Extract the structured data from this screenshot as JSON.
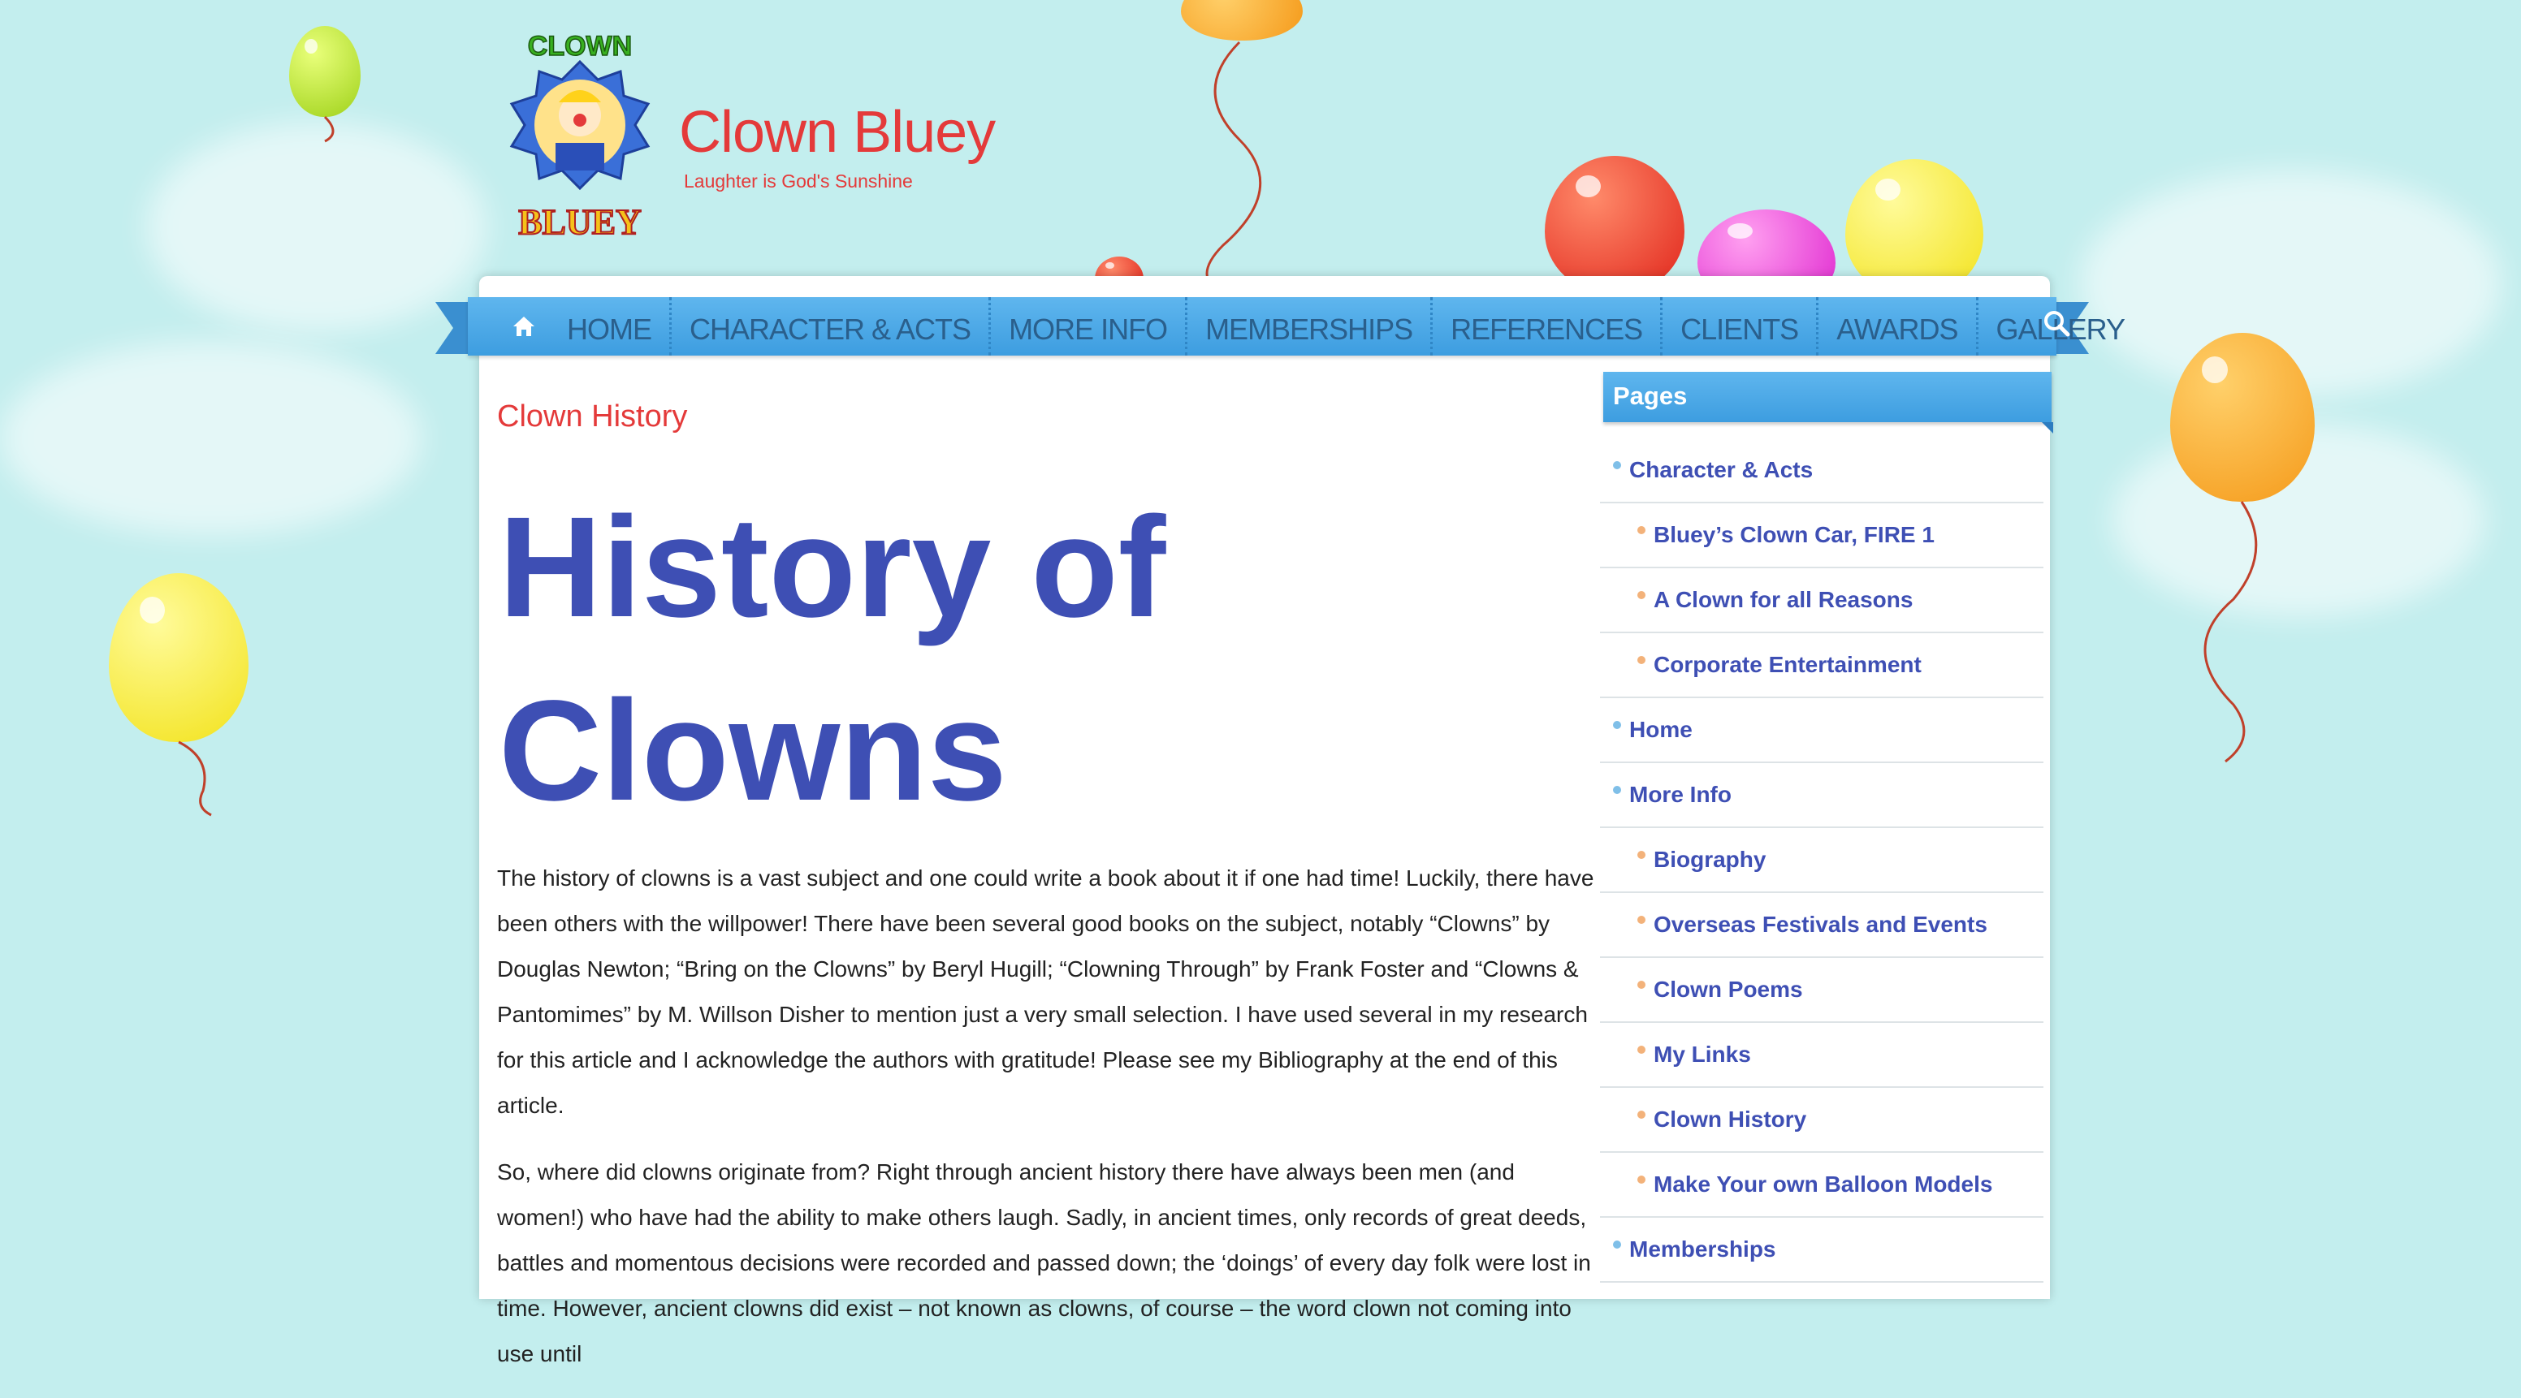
{
  "site": {
    "title": "Clown Bluey",
    "tagline": "Laughter is God's Sunshine",
    "logo_text_top": "CLOWN",
    "logo_text_bottom": "BLUEY"
  },
  "nav": {
    "items": [
      "HOME",
      "CHARACTER & ACTS",
      "MORE INFO",
      "MEMBERSHIPS",
      "REFERENCES",
      "CLIENTS",
      "AWARDS",
      "GALLERY"
    ],
    "home_icon": "home-icon",
    "search_icon": "search-icon"
  },
  "main": {
    "page_title": "Clown History",
    "headline_line1": "History of",
    "headline_line2": "Clowns",
    "paragraphs": [
      "The history of clowns is a vast subject and one could write a book about it if one had time! Luckily, there have been others with the willpower! There have been several good books on the subject, notably “Clowns” by Douglas Newton; “Bring on the Clowns” by Beryl Hugill; “Clowning Through” by Frank Foster and “Clowns & Pantomimes” by M. Willson Disher to mention just a very small selection. I have used several in my research for this article and I acknowledge the authors with gratitude! Please see my Bibliography at the end of this article.",
      "So, where did clowns originate from? Right through ancient history there have always been men (and women!) who have had the ability to make others laugh. Sadly, in ancient times, only records of great deeds, battles and momentous decisions were recorded and passed down; the ‘doings’ of every day folk were lost in time. However, ancient clowns did exist – not known as clowns, of course – the word clown not coming into use until"
    ]
  },
  "sidebar": {
    "widget_title": "Pages",
    "items": [
      {
        "label": "Character & Acts",
        "level": 1
      },
      {
        "label": "Bluey’s Clown Car, FIRE 1",
        "level": 2
      },
      {
        "label": "A Clown for all Reasons",
        "level": 2
      },
      {
        "label": "Corporate Entertainment",
        "level": 2
      },
      {
        "label": "Home",
        "level": 1
      },
      {
        "label": "More Info",
        "level": 1
      },
      {
        "label": "Biography",
        "level": 2
      },
      {
        "label": "Overseas Festivals and Events",
        "level": 2
      },
      {
        "label": "Clown Poems",
        "level": 2
      },
      {
        "label": "My Links",
        "level": 2
      },
      {
        "label": "Clown History",
        "level": 2
      },
      {
        "label": "Make Your own Balloon Models",
        "level": 2
      },
      {
        "label": "Memberships",
        "level": 1
      }
    ]
  },
  "colors": {
    "sky": "#c3eeee",
    "nav_blue": "#4aa8e8",
    "title_red": "#e43a3a",
    "headline_blue": "#3e4fb4"
  }
}
